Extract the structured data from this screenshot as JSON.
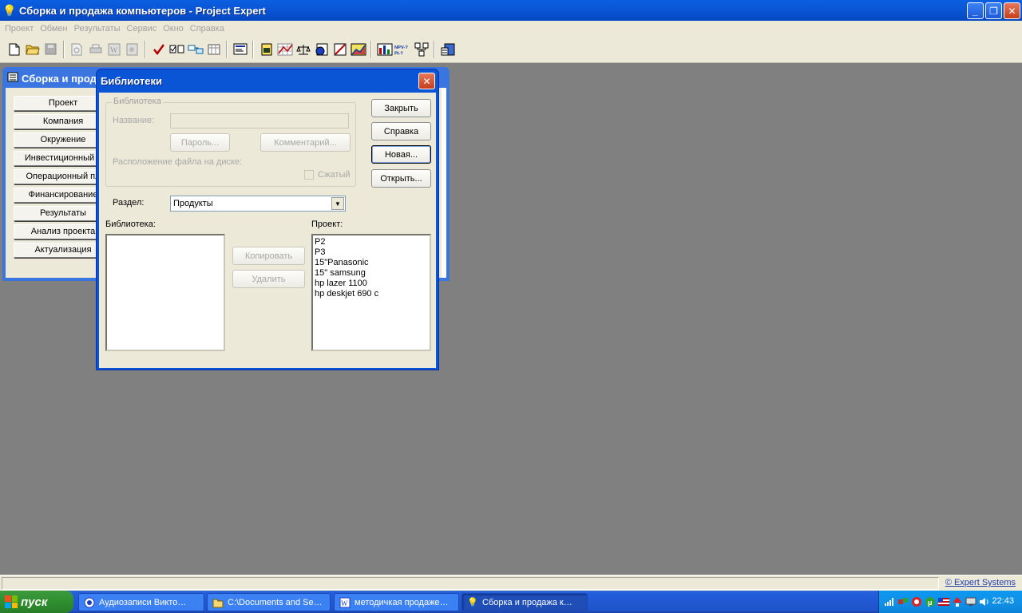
{
  "window": {
    "title": "Сборка и продажа компьютеров - Project Expert",
    "minimize": "_",
    "restore": "❐",
    "close": "✕"
  },
  "menu": [
    "Проект",
    "Обмен",
    "Результаты",
    "Сервис",
    "Окно",
    "Справка"
  ],
  "mdi": {
    "title": "Сборка и прод",
    "sidebar": [
      "Проект",
      "Компания",
      "Окружение",
      "Инвестиционный п",
      "Операционный пл",
      "Финансирование",
      "Результаты",
      "Анализ проекта",
      "Актуализация"
    ]
  },
  "dialog": {
    "title": "Библиотеки",
    "close": "✕",
    "group_legend": "Библиотека",
    "name_label": "Название:",
    "name_value": "",
    "password_button": "Пароль...",
    "comment_button": "Комментарий...",
    "file_location_label": "Расположение файла на диске:",
    "compressed_label": "Сжатый",
    "buttons": {
      "close": "Закрыть",
      "help": "Справка",
      "new": "Новая...",
      "open": "Открыть..."
    },
    "section_label": "Раздел:",
    "section_value": "Продукты",
    "library_label": "Библиотека:",
    "project_label": "Проект:",
    "copy_button": "Копировать",
    "delete_button": "Удалить",
    "library_items": [],
    "project_items": [
      "P2",
      "P3",
      "15\"Panasonic",
      "15\" samsung",
      "hp lazer 1100",
      "hp deskjet 690 c"
    ]
  },
  "statusbar": {
    "link": "© Expert Systems"
  },
  "taskbar": {
    "start": "пуск",
    "tasks": [
      "Аудиозаписи Викто…",
      "C:\\Documents and Se…",
      "методичкая продаже…",
      "Сборка и продажа к…"
    ],
    "clock": "22:43"
  }
}
